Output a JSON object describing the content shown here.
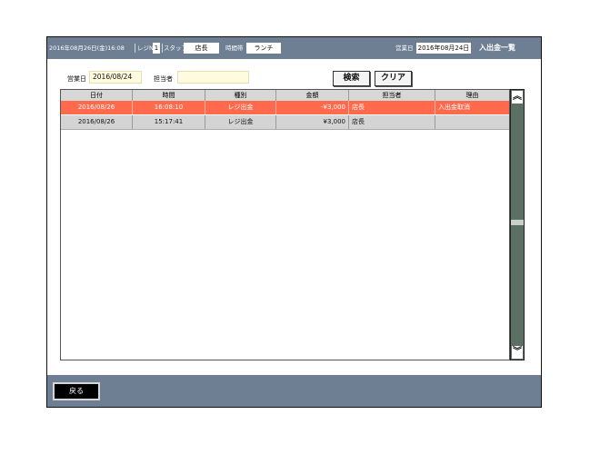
{
  "topbar": {
    "datetime": "2016年08月26日(金)16:08",
    "reg_label": "レジNo",
    "reg_no": "1",
    "staff_label": "スタッフ",
    "staff_value": "店長",
    "period_label": "時間帯",
    "period_value": "ランチ",
    "bizdate_label": "営業日",
    "bizdate_value": "2016年08月24日",
    "title": "入出金一覧"
  },
  "search": {
    "date_label": "営業日",
    "date_value": "2016/08/24",
    "person_label": "担当者",
    "person_value": "",
    "search_btn": "検索",
    "clear_btn": "クリア"
  },
  "table": {
    "headers": [
      "日付",
      "時間",
      "種別",
      "金額",
      "担当者",
      "理由"
    ],
    "rows": [
      [
        "2016/08/26",
        "16:08:10",
        "レジ出金",
        "-¥3,000",
        "店長",
        "入出金取消"
      ],
      [
        "2016/08/26",
        "15:17:41",
        "レジ出金",
        "¥3,000",
        "店長",
        ""
      ]
    ]
  },
  "scroll": {
    "up_icon": "double-chevron-up-icon",
    "down_icon": "double-chevron-down-icon",
    "up_glyph": "︽",
    "down_glyph": "︾"
  },
  "footer": {
    "back_btn": "戻る"
  },
  "colors": {
    "bar": "#6f7f93",
    "selected_row": "#ff6a4d",
    "scrollbar": "#5b6f64"
  }
}
